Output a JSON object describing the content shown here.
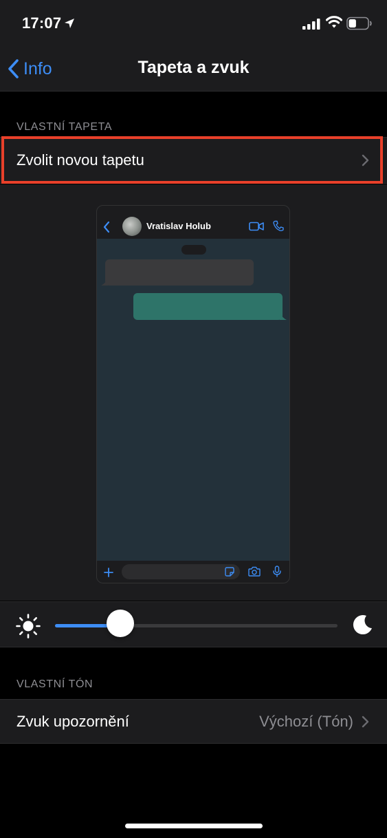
{
  "status_bar": {
    "time": "17:07",
    "battery_level": 0.4
  },
  "nav": {
    "back_label": "Info",
    "title": "Tapeta a zvuk"
  },
  "wallpaper_section": {
    "header": "VLASTNÍ TAPETA",
    "choose_label": "Zvolit novou tapetu"
  },
  "preview": {
    "contact_name": "Vratislav Holub"
  },
  "brightness": {
    "level": 0.23
  },
  "tone_section": {
    "header": "VLASTNÍ TÓN",
    "notification_label": "Zvuk upozornění",
    "notification_value": "Výchozí (Tón)"
  },
  "colors": {
    "accent": "#3d8df5",
    "highlight": "#e8402a",
    "outgoing_bubble": "#2e7469",
    "chat_background": "#23313a"
  }
}
